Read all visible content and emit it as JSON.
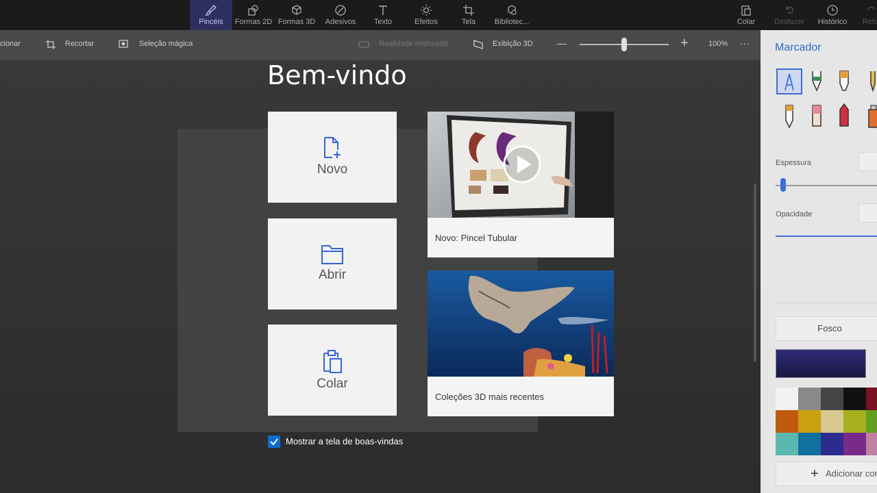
{
  "topbar": {
    "tools": [
      {
        "label": "Pincéis",
        "icon": "brush-icon"
      },
      {
        "label": "Formas 2D",
        "icon": "shapes-2d-icon"
      },
      {
        "label": "Formas 3D",
        "icon": "cube-icon"
      },
      {
        "label": "Adesivos",
        "icon": "sticker-icon"
      },
      {
        "label": "Texto",
        "icon": "text-icon"
      },
      {
        "label": "Efeitos",
        "icon": "sun-icon"
      },
      {
        "label": "Tela",
        "icon": "crop-canvas-icon"
      },
      {
        "label": "Bibliotec...",
        "icon": "library-icon"
      }
    ],
    "right": [
      {
        "label": "Colar",
        "icon": "paste-icon"
      },
      {
        "label": "Desfazer",
        "icon": "undo-icon"
      },
      {
        "label": "Histórico",
        "icon": "history-icon"
      },
      {
        "label": "Refazer",
        "icon": "redo-icon"
      }
    ]
  },
  "toolbar2": {
    "select": "cionar",
    "crop": "Recortar",
    "magic": "Seleção mágica",
    "mixed": "Realidade misturada",
    "view3d": "Exibição 3D",
    "minus": "—",
    "plus": "+",
    "zoom": "100%",
    "more": "···",
    "zoom_fraction": 0.5
  },
  "welcome": {
    "title": "Bem-vindo",
    "tiles": [
      {
        "label": "Novo",
        "icon": "new-file-icon"
      },
      {
        "label": "Abrir",
        "icon": "folder-icon"
      },
      {
        "label": "Colar",
        "icon": "paste-icon"
      }
    ],
    "cards": [
      {
        "text": "Novo: Pincel Tubular"
      },
      {
        "text": "Coleções 3D mais recentes"
      }
    ],
    "show_welcome_label": "Mostrar a tela de boas-vindas",
    "show_welcome_checked": true
  },
  "panel": {
    "title": "Marcador",
    "thickness_label": "Espessura",
    "opacity_label": "Opacidade",
    "finish": "Fosco",
    "current_color": "#2e2a78",
    "add_color": "Adicionar cor",
    "palette": [
      "#f2f2f2",
      "#8a8a8a",
      "#444444",
      "#111111",
      "#7a1020",
      "#c05a10",
      "#c8a010",
      "#d8c890",
      "#a8b020",
      "#60a020",
      "#5ab8b0",
      "#1070a0",
      "#2c2c8c",
      "#7a2a8a",
      "#c080a0"
    ]
  }
}
